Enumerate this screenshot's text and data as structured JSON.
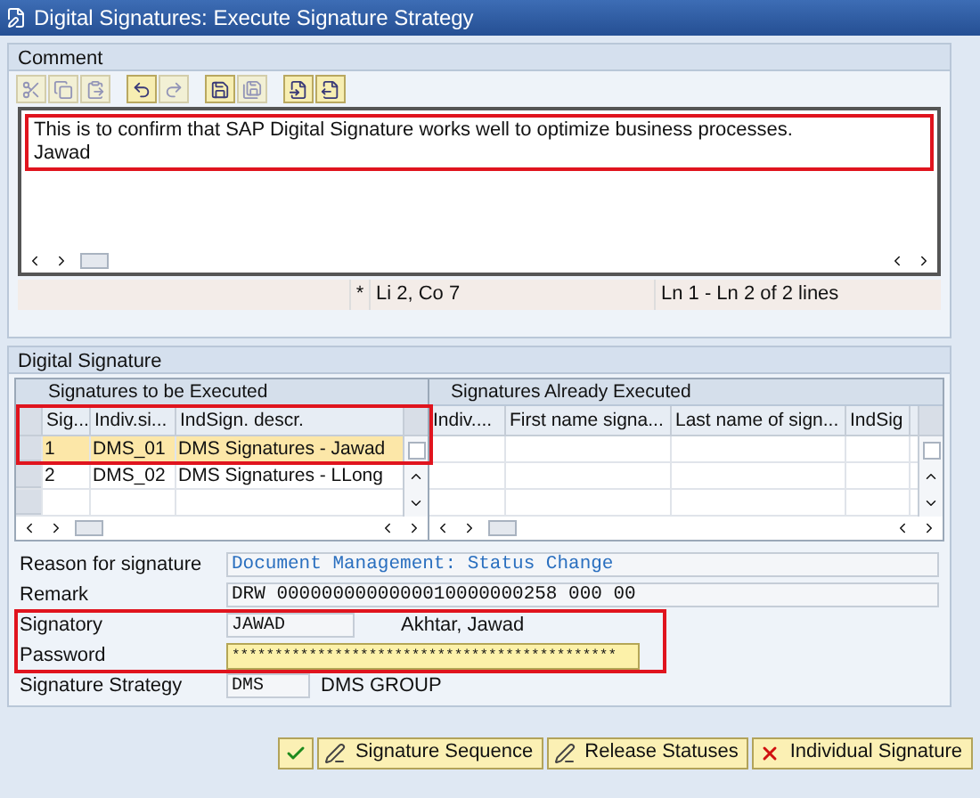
{
  "window": {
    "title": "Digital Signatures: Execute Signature Strategy"
  },
  "comment": {
    "header": "Comment",
    "lines": [
      "This is to confirm that SAP Digital Signature works well to optimize business processes.",
      "Jawad"
    ],
    "status": {
      "modified": "*",
      "position": "Li 2, Co 7",
      "range": "Ln 1 - Ln 2 of 2 lines"
    }
  },
  "digital_signature": {
    "header": "Digital Signature",
    "to_execute": {
      "title": "Signatures to be Executed",
      "columns": [
        "Sig...",
        "Indiv.si...",
        "IndSign. descr."
      ],
      "rows": [
        {
          "cells": [
            "1",
            "DMS_01",
            "DMS Signatures - Jawad"
          ],
          "selected": true
        },
        {
          "cells": [
            "2",
            "DMS_02",
            "DMS Signatures - LLong"
          ],
          "selected": false
        }
      ]
    },
    "executed": {
      "title": "Signatures Already Executed",
      "columns": [
        "Indiv....",
        "First name signa...",
        "Last name of sign...",
        "IndSig"
      ]
    },
    "fields": [
      {
        "kind": "note",
        "label": "Reason for signature",
        "value": "Document Management: Status Change"
      },
      {
        "kind": "display",
        "label": "Remark",
        "value": "DRW 0000000000000010000000258 000 00"
      },
      {
        "kind": "short",
        "label": "Signatory",
        "value": "JAWAD",
        "extra": "Akhtar, Jawad"
      },
      {
        "kind": "password",
        "label": "Password",
        "value": "*********************************************"
      },
      {
        "kind": "short",
        "label": "Signature Strategy",
        "value": "DMS",
        "extra": "DMS GROUP"
      }
    ]
  },
  "buttons": [
    {
      "kind": "confirm"
    },
    {
      "kind": "signature",
      "label": "Signature Sequence"
    },
    {
      "kind": "signature",
      "label": "Release Statuses"
    },
    {
      "kind": "cancel",
      "label": "Individual Signature"
    }
  ]
}
